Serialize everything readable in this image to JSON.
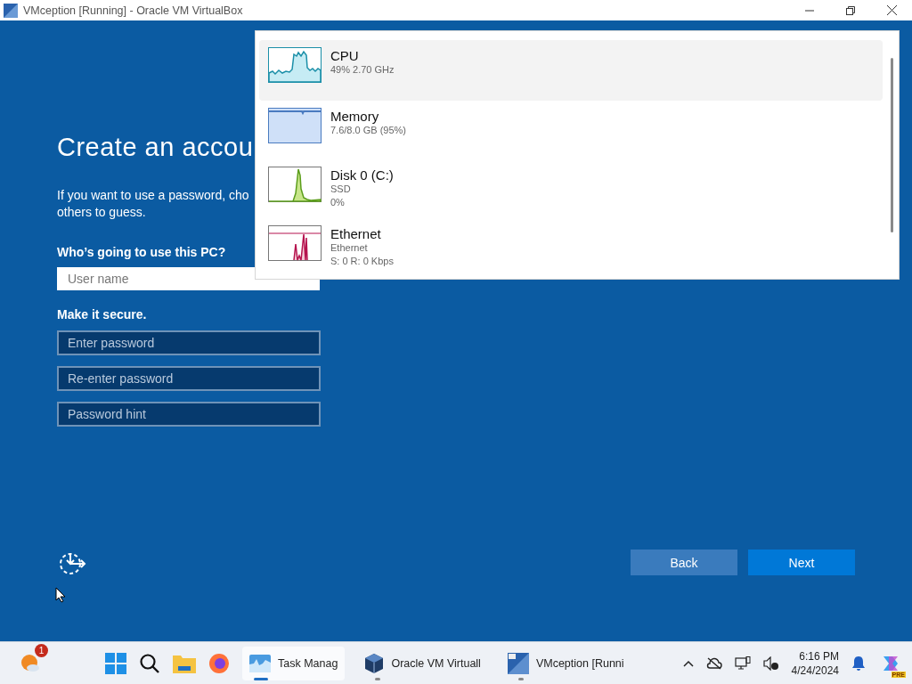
{
  "window": {
    "title": "VMception [Running] - Oracle VM VirtualBox"
  },
  "setup": {
    "heading": "Create an accou",
    "description_lines": [
      "If you want to use a password, cho",
      "others to guess."
    ],
    "who_label": "Who’s going to use this PC?",
    "username": {
      "placeholder": "User name"
    },
    "secure_label": "Make it secure.",
    "password_fields": [
      {
        "placeholder": "Enter password"
      },
      {
        "placeholder": "Re-enter password"
      },
      {
        "placeholder": "Password hint"
      }
    ],
    "buttons": [
      {
        "label": "Back",
        "kind": "secondary"
      },
      {
        "label": "Next",
        "kind": "primary"
      }
    ]
  },
  "performance_popup": {
    "items": [
      {
        "kind": "cpu",
        "name": "CPU",
        "details": [
          "49% 2.70 GHz"
        ],
        "color": "#1a8fa8",
        "selected": true
      },
      {
        "kind": "memory",
        "name": "Memory",
        "details": [
          "7.6/8.0 GB (95%)"
        ],
        "color": "#4a7bc0",
        "selected": false
      },
      {
        "kind": "disk",
        "name": "Disk 0 (C:)",
        "details": [
          "SSD",
          "0%"
        ],
        "color": "#5c9e1c",
        "selected": false
      },
      {
        "kind": "network",
        "name": "Ethernet",
        "details": [
          "Ethernet",
          "S: 0 R: 0 Kbps"
        ],
        "color": "#b5124e",
        "selected": false
      }
    ]
  },
  "taskbar": {
    "weather_badge": "1",
    "apps": [
      {
        "kind": "taskmgr",
        "label": "Task Manag",
        "selected": true
      },
      {
        "kind": "vbox",
        "label": "Oracle VM Virtuall",
        "selected": false
      },
      {
        "kind": "vm",
        "label": "VMception [Runni",
        "selected": false
      }
    ],
    "time": "6:16 PM",
    "date": "4/24/2024",
    "copilot_badge": "PRE"
  }
}
